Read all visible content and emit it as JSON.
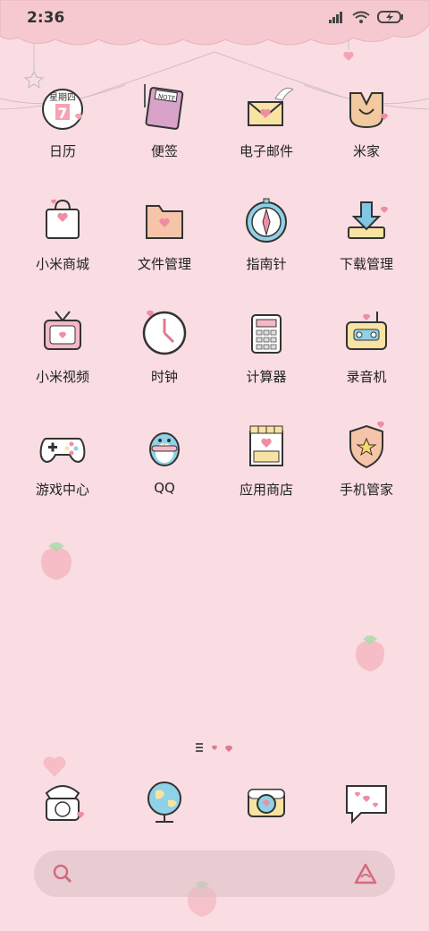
{
  "status_bar": {
    "time": "2:36",
    "icons": [
      "signal-icon",
      "wifi-icon",
      "battery-charging-icon"
    ]
  },
  "calendar": {
    "weekday": "星期四",
    "day": "7"
  },
  "apps": [
    {
      "label": "日历",
      "icon": "calendar-icon"
    },
    {
      "label": "便签",
      "icon": "notes-icon"
    },
    {
      "label": "电子邮件",
      "icon": "mail-icon"
    },
    {
      "label": "米家",
      "icon": "mijia-icon"
    },
    {
      "label": "小米商城",
      "icon": "store-bag-icon"
    },
    {
      "label": "文件管理",
      "icon": "folder-icon"
    },
    {
      "label": "指南针",
      "icon": "compass-icon"
    },
    {
      "label": "下载管理",
      "icon": "download-icon"
    },
    {
      "label": "小米视频",
      "icon": "tv-icon"
    },
    {
      "label": "时钟",
      "icon": "clock-icon"
    },
    {
      "label": "计算器",
      "icon": "calculator-icon"
    },
    {
      "label": "录音机",
      "icon": "recorder-icon"
    },
    {
      "label": "游戏中心",
      "icon": "gamepad-icon"
    },
    {
      "label": "QQ",
      "icon": "penguin-icon"
    },
    {
      "label": "应用商店",
      "icon": "shop-icon"
    },
    {
      "label": "手机管家",
      "icon": "shield-icon"
    }
  ],
  "dock": [
    {
      "icon": "phone-icon"
    },
    {
      "icon": "globe-icon"
    },
    {
      "icon": "camera-icon"
    },
    {
      "icon": "message-icon"
    }
  ],
  "search_bar": {
    "left_icon": "search-icon",
    "right_icon": "assistant-icon"
  },
  "colors": {
    "background": "#f9dde2",
    "accent_pink": "#ef8ea2",
    "line": "#555555"
  }
}
